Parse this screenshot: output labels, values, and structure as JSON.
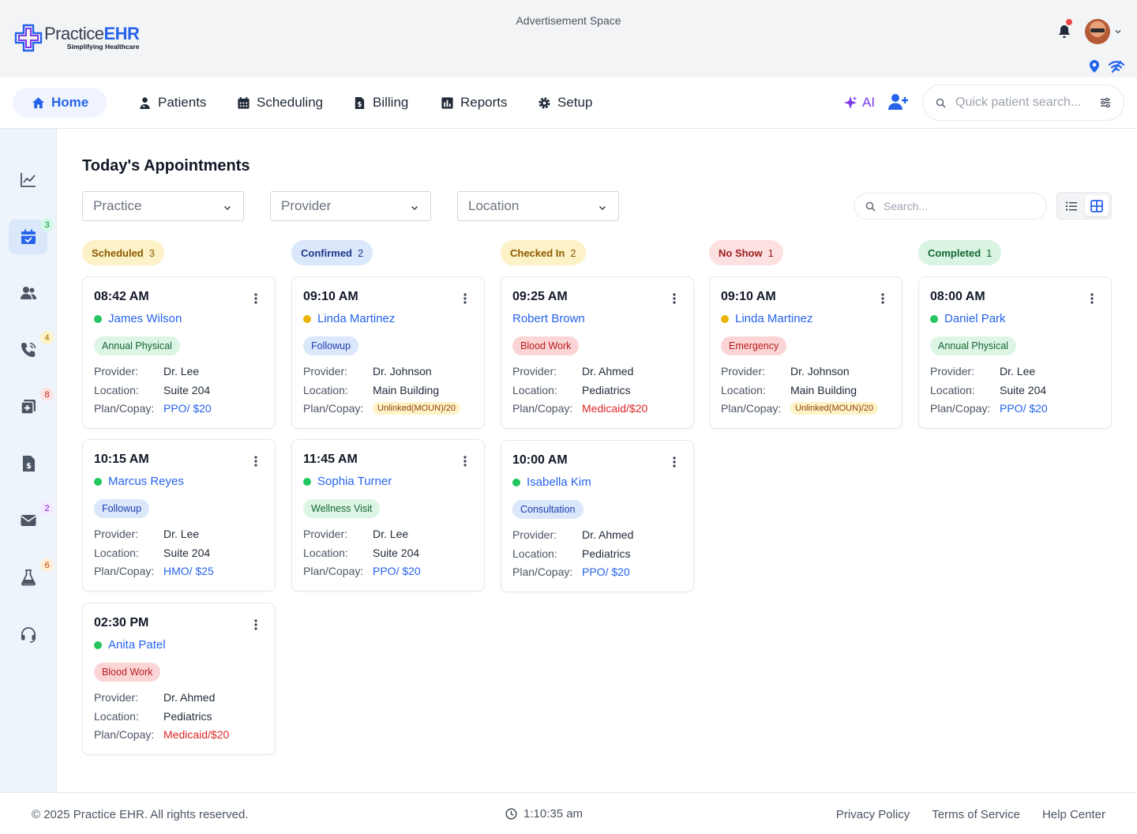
{
  "brand": {
    "name_part1": "Practice",
    "name_part2": "EHR",
    "tagline": "Simplifying Healthcare"
  },
  "header": {
    "ad_text": "Advertisement Space"
  },
  "nav": {
    "items": [
      {
        "label": "Home",
        "icon": "home-icon",
        "active": true
      },
      {
        "label": "Patients",
        "icon": "patient-icon"
      },
      {
        "label": "Scheduling",
        "icon": "calendar-icon"
      },
      {
        "label": "Billing",
        "icon": "invoice-icon"
      },
      {
        "label": "Reports",
        "icon": "chart-icon"
      },
      {
        "label": "Setup",
        "icon": "gear-icon"
      }
    ],
    "ai_label": "AI",
    "quick_search_placeholder": "Quick patient search..."
  },
  "sidebar": {
    "items": [
      {
        "name": "analytics",
        "icon": "line-chart-icon",
        "badge": ""
      },
      {
        "name": "appointments",
        "icon": "calendar-check-icon",
        "badge": "3",
        "active": true
      },
      {
        "name": "patients",
        "icon": "users-icon",
        "badge": ""
      },
      {
        "name": "calls",
        "icon": "phone-icon",
        "badge": "4"
      },
      {
        "name": "clinical",
        "icon": "medical-plus-icon",
        "badge": "8"
      },
      {
        "name": "billing",
        "icon": "invoice-dollar-icon",
        "badge": ""
      },
      {
        "name": "messages",
        "icon": "mail-icon",
        "badge": "2"
      },
      {
        "name": "labs",
        "icon": "flask-icon",
        "badge": "6"
      },
      {
        "name": "support",
        "icon": "headset-icon",
        "badge": ""
      }
    ]
  },
  "page": {
    "title": "Today's Appointments"
  },
  "filters": {
    "practice": "Practice",
    "provider": "Provider",
    "location": "Location",
    "search_placeholder": "Search..."
  },
  "labels": {
    "provider": "Provider:",
    "location": "Location:",
    "plan": "Plan/Copay:"
  },
  "columns": [
    {
      "status": "Scheduled",
      "count": "3",
      "color": "#fdf1c7",
      "text": "#8a5a00",
      "cards": [
        {
          "time": "08:42 AM",
          "patient": "James Wilson",
          "dot": "#22c55e",
          "type": "Annual Physical",
          "type_style": "green",
          "provider": "Dr. Lee",
          "location": "Suite 204",
          "plan": "PPO/ $20",
          "plan_style": "blue"
        },
        {
          "time": "10:15 AM",
          "patient": "Marcus Reyes",
          "dot": "#22c55e",
          "type": "Followup",
          "type_style": "blue",
          "provider": "Dr. Lee",
          "location": "Suite 204",
          "plan": "HMO/ $25",
          "plan_style": "blue"
        },
        {
          "time": "02:30 PM",
          "patient": "Anita Patel",
          "dot": "#22c55e",
          "type": "Blood Work",
          "type_style": "red",
          "provider": "Dr. Ahmed",
          "location": "Pediatrics",
          "plan": "Medicaid/$20",
          "plan_style": "red"
        }
      ]
    },
    {
      "status": "Confirmed",
      "count": "2",
      "color": "#dbe7fb",
      "text": "#1e3a8a",
      "cards": [
        {
          "time": "09:10 AM",
          "patient": "Linda Martinez",
          "dot": "#eab308",
          "type": "Followup",
          "type_style": "blue",
          "provider": "Dr. Johnson",
          "location": "Main Building",
          "plan": "Unlinked(MOUN)/20",
          "plan_style": "unlinked"
        },
        {
          "time": "11:45 AM",
          "patient": "Sophia Turner",
          "dot": "#22c55e",
          "type": "Wellness Visit",
          "type_style": "green",
          "provider": "Dr. Lee",
          "location": "Suite 204",
          "plan": "PPO/ $20",
          "plan_style": "blue"
        }
      ]
    },
    {
      "status": "Checked In",
      "count": "2",
      "color": "#fdf1c7",
      "text": "#8a5a00",
      "cards": [
        {
          "time": "09:25 AM",
          "patient": "Robert Brown",
          "dot": "",
          "type": "Blood Work",
          "type_style": "red",
          "provider": "Dr. Ahmed",
          "location": "Pediatrics",
          "plan": "Medicaid/$20",
          "plan_style": "red"
        },
        {
          "time": "10:00 AM",
          "patient": "Isabella Kim",
          "dot": "#22c55e",
          "type": "Consultation",
          "type_style": "blue",
          "provider": "Dr. Ahmed",
          "location": "Pediatrics",
          "plan": "PPO/ $20",
          "plan_style": "blue"
        }
      ]
    },
    {
      "status": "No Show",
      "count": "1",
      "color": "#fde0e0",
      "text": "#9b1c1c",
      "cards": [
        {
          "time": "09:10 AM",
          "patient": "Linda Martinez",
          "dot": "#eab308",
          "type": "Emergency",
          "type_style": "red",
          "provider": "Dr. Johnson",
          "location": "Main Building",
          "plan": "Unlinked(MOUN)/20",
          "plan_style": "unlinked"
        }
      ]
    },
    {
      "status": "Completed",
      "count": "1",
      "color": "#d9f5e2",
      "text": "#166534",
      "cards": [
        {
          "time": "08:00 AM",
          "patient": "Daniel Park",
          "dot": "#22c55e",
          "type": "Annual Physical",
          "type_style": "green",
          "provider": "Dr. Lee",
          "location": "Suite 204",
          "plan": "PPO/ $20",
          "plan_style": "blue"
        }
      ]
    }
  ],
  "footer": {
    "copyright": "© 2025 Practice EHR. All rights reserved.",
    "time": "1:10:35 am",
    "links": [
      "Privacy Policy",
      "Terms of Service",
      "Help Center"
    ]
  }
}
